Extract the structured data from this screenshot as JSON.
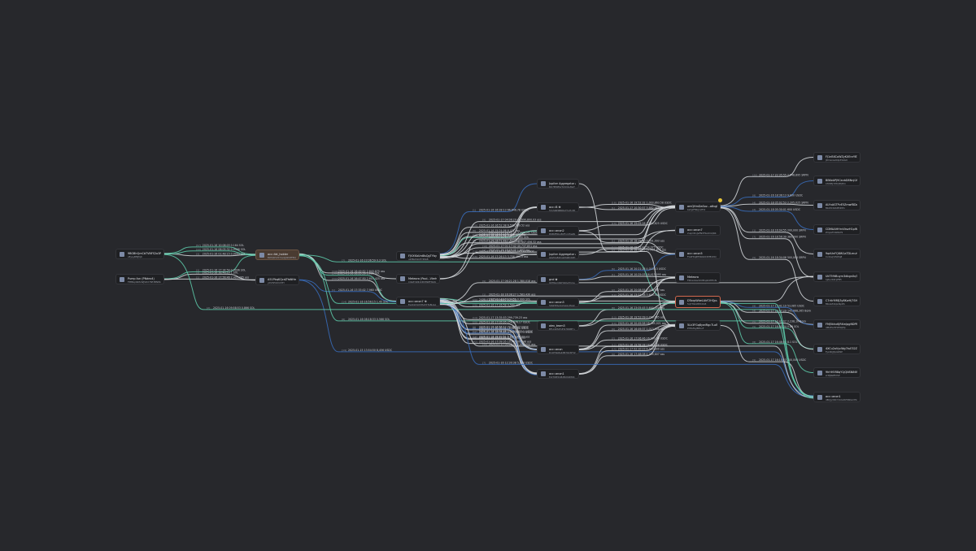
{
  "colors": {
    "background": "#27282c",
    "node_bg": "#1f2023",
    "edge_teal": "#5fcfae",
    "edge_blue": "#3a6fbf",
    "edge_white": "#d7dade",
    "edge_grey": "#8d9099",
    "highlight_node": "#4a3b31",
    "selected_border": "#d2694e",
    "badge": "#e8c53a"
  },
  "nodes": [
    {
      "id": "n1",
      "icon": "wallet-icon",
      "title": "9BGBhQmCbTVNFS2o3PYqnRcAFbqsAR9n",
      "sub": "vEyLyBMJfqK"
    },
    {
      "id": "n2",
      "icon": "wallet-icon",
      "title": "Pump.fun (PNdex4)",
      "sub": "FP8Nq4bMvWJSDX76E3BN8bKGzdYje7Pz8 DSGJ4b7Zu9"
    },
    {
      "id": "n3",
      "icon": "wallet-icon",
      "title": "acc::fat_holder",
      "sub": "BWQWvMrmsdgWU8FBQ7wnc3fG4nqzzbefQ WnXpGQRQCfE"
    },
    {
      "id": "n4",
      "icon": "wallet-icon",
      "title": "A51PbqKQcdZYaNHmoU9ryBAgKKHrfgj",
      "sub": "ybVW54mCfZY"
    },
    {
      "id": "n5",
      "icon": "wallet-icon",
      "title": "FJVXKbUrd8sQgTYbyRBjsLnaTn2vB6HKqn",
      "sub": "uZtNyDxkHYRtpB"
    },
    {
      "id": "n6",
      "icon": "wallet-icon",
      "title": "Meteora (Pool...Vlerhsnlb)",
      "sub": "C9zZYkNUV4MHWfHSdKwd2PYRWHSFACXQ Te5Cpu6TG9t"
    },
    {
      "id": "n7",
      "icon": "wallet-icon",
      "title": "acc::anon7 ☢",
      "sub": "Ee1JjkX1XVHeTdTLBLGAVb1w9YeMQpQ7tl ZpY4GEHPbWmXE"
    },
    {
      "id": "n8",
      "icon": "agg-icon",
      "title": "Jupiter Aggregator Authority...",
      "sub": "BQ7BfjMSxTyVQ2uMaTBvYTX4v9mnBY5 u3TuCpn7ogx"
    },
    {
      "id": "n9",
      "icon": "wallet-icon",
      "title": "acc::B ☢",
      "sub": "5YuSRZSBRRgYhyHcPXBSgNVZfF6Rwm68 Yf6tFC6mSAEMsz"
    },
    {
      "id": "n10",
      "icon": "wallet-icon",
      "title": "acc::anon2",
      "sub": "DKBdF6bu5DFnrdhwPqaVHGmKdbVAgKqaV NQBkVQFD4"
    },
    {
      "id": "n11",
      "icon": "agg-icon",
      "title": "Jupiter Aggregator Authority 1...",
      "sub": "GKZXp84XqsMg6DXZHrq4Ubgh6yBQvT3k Ab4qGeSqdjwSN"
    },
    {
      "id": "n12",
      "icon": "wallet-icon",
      "title": "grol ✿",
      "sub": "9XTNuCjRkHj4Xe7hmeLbGdR1f3nMa1aaPZ9 pQAgDVuyrG"
    },
    {
      "id": "n13",
      "icon": "wallet-icon",
      "title": "acc::anon3",
      "sub": "5bW5Mv2pVyJzqyHpzz7bSkwYtHuqq1qYFk XDXQaHAWVnBZ6"
    },
    {
      "id": "n14",
      "icon": "wallet-icon",
      "title": "alex_team3",
      "sub": "BFLk2MgFxEhj7DRBTn9uRcGX8TXhKzaKcB a2AuMnSZM38"
    },
    {
      "id": "n15",
      "icon": "wallet-icon",
      "title": "acc::anon",
      "sub": "D1QFRgPeK3B7KCSF32GkYxyJ3FcEXbZ3GD Tp8aHAU6VVSPx"
    },
    {
      "id": "n16",
      "icon": "wallet-icon",
      "title": "acc::anon1",
      "sub": "ELt7JREXnBzBUXkMCKSkFmsCwTYKS4h1uHBi 4uLZhQPw"
    },
    {
      "id": "n17",
      "icon": "wallet-icon",
      "title": "amQHmDaSoz...a6vgNkgJHMpoYqTsEmbP",
      "sub": "bsVjzFMbj1LfH4"
    },
    {
      "id": "n18",
      "icon": "wallet-icon",
      "title": "acc::anon7",
      "sub": "2uqmDvJvPNVFKu6mQR47xLpyzQuHyKZ Br7n3NdCb4X7"
    },
    {
      "id": "n19",
      "icon": "wallet-icon",
      "title": "acc::anon5",
      "sub": "FG9Htq6fMWa6XDYBUDQXkxPp9Wfu2QqLT 4TLYKbkMPp2"
    },
    {
      "id": "n20",
      "icon": "wallet-icon",
      "title": "Meteora",
      "sub": "FKCavzavzUXBnpK4HHnNbmnBvgxdYDMVpY Cm3nAHUxuY2G"
    },
    {
      "id": "n21",
      "icon": "wallet-icon",
      "title": "DToxpWbeLAkF2HQpuo9Ss8SBWJy9W15",
      "sub": "5q7T9z1HPCXA5"
    },
    {
      "id": "n22",
      "icon": "wallet-icon",
      "title": "5Lk3FGq8ywiRgc7LoBkMrqd4Z3MHZnHH",
      "sub": "P7BxfbyBEbuF"
    },
    {
      "id": "n23",
      "icon": "wallet-icon",
      "title": "FJ1nBXCoWZyKXEnrYBTQr8Y9M27A8nsY",
      "sub": "JDmsxLa9dp3VAG9"
    },
    {
      "id": "n24",
      "icon": "wallet-icon",
      "title": "BBKeAPJ9CevbD8Nnj0Ag8oRMk77Ab9U",
      "sub": "Cf93EJYPXQPQPm"
    },
    {
      "id": "n25",
      "icon": "wallet-icon",
      "title": "ALYxAGTPvE5ZmwfBDoAAbAu9Wwb5rtFG2",
      "sub": "MkWCSdbB5Pdfv"
    },
    {
      "id": "n26",
      "icon": "wallet-icon",
      "title": "CDMAAHHrvVkszH1pWDi19FHnmVS5wxGQ",
      "sub": "ZmjoZ3dk8AY9"
    },
    {
      "id": "n27",
      "icon": "wallet-icon",
      "title": "9qdUnFQ8W1aTDLmuhm4SRGWtt3Qk9G7gBo",
      "sub": "Cx1GqVWWq8"
    },
    {
      "id": "n28",
      "icon": "wallet-icon",
      "title": "UkT59tBuyrn3dbgnXq7qkjAhP7ZEPYfXSA",
      "sub": "hJALxSNrpFB5"
    },
    {
      "id": "n29",
      "icon": "wallet-icon",
      "title": "C7rtkYM8J3y8KwHj7SHr2xCgtrqtWmBpGD",
      "sub": "MbskZdkpLNpDS"
    },
    {
      "id": "n30",
      "icon": "wallet-icon",
      "title": "FMJ5khx6jRKmJqgftDPBRnd2TtVMYydQS4U9",
      "sub": "4MAtSx5HdMqMp"
    },
    {
      "id": "n31",
      "icon": "wallet-icon",
      "title": "4XCu2oVycWg7tuE32Zr5hpYB5snvCmpW",
      "sub": "FyLNQJ3pGNSP"
    },
    {
      "id": "n32",
      "icon": "wallet-icon",
      "title": "9hHH5R8qY1jQNSN86SDWKF2WxeTFYmqEN",
      "sub": "zrMJRefEXSP"
    },
    {
      "id": "n33",
      "icon": "wallet-icon",
      "title": "acc::anon1",
      "sub": "4BCJyVRCY1UG2KT9NGmEbjbQN7jEbFz3Z2BRqRPEU MiLkM"
    }
  ],
  "edges": [
    {
      "from": "n1",
      "to": "n3",
      "color": "teal",
      "label": "2025-01-16 10:08:03 0.164 SOL",
      "tag": "[57]"
    },
    {
      "from": "n1",
      "to": "n3",
      "color": "white",
      "label": "2025-01-16 01:48:15 0.0095 SOL",
      "tag": "[3]"
    },
    {
      "from": "n1",
      "to": "n3",
      "color": "teal",
      "label": "2025-01-16 06:05:32 0.0598 SOL",
      "tag": "[10]"
    },
    {
      "from": "n2",
      "to": "n3",
      "color": "teal",
      "label": "2025-01-16 17:34:54 0.3096 SOL",
      "tag": "[3]"
    },
    {
      "from": "n2",
      "to": "n4",
      "color": "white",
      "label": "2025-01-16 17:56:46 2,495,365 ass",
      "tag": "[1]"
    },
    {
      "from": "n2",
      "to": "n4",
      "color": "white",
      "label": "2025-01-16 16:46:29 1 SOL",
      "tag": "[3]"
    },
    {
      "from": "n3",
      "to": "n7",
      "color": "white",
      "label": "2025-01-16 16:47:50 2,603,425 ass",
      "tag": "[342]"
    },
    {
      "from": "n3",
      "to": "n7",
      "color": "teal",
      "label": "2025-01-16 16:25:59 1.025 SOL",
      "tag": "[344]"
    },
    {
      "from": "n3",
      "to": "n6",
      "color": "white",
      "label": "2025-01-16 16:49:52 2,643,875 ass",
      "tag": "[346]"
    },
    {
      "from": "n4",
      "to": "n7",
      "color": "blue",
      "label": "2025-01-16 17:33:02 7,960 USDC",
      "tag": "[1]"
    },
    {
      "from": "n3",
      "to": "n21",
      "color": "teal",
      "label": "2025-01-16 23:36:59 0.3 SOL",
      "tag": "[7]"
    },
    {
      "from": "n4",
      "to": "n33",
      "color": "blue",
      "label": "2025-01-15 13:54:50 8,456 USDC",
      "tag": "[19]"
    },
    {
      "from": "n3",
      "to": "n33",
      "color": "teal",
      "label": "2025-01-16 08:18:33 0.566 SOL",
      "tag": "[8]"
    },
    {
      "from": "n5",
      "to": "n8",
      "color": "blue",
      "label": "2025-01-16 16:28:13 66,646.78 USDC",
      "tag": "[1]"
    },
    {
      "from": "n5",
      "to": "n9",
      "color": "white",
      "label": "2025-01-16 15:24:06 6,477 ass",
      "tag": "[8]"
    },
    {
      "from": "n5",
      "to": "n9",
      "color": "white",
      "label": "2025-01-16 16:52:38 6,596,389.52 ass",
      "tag": "[10]"
    },
    {
      "from": "n5",
      "to": "n9",
      "color": "white",
      "label": "2025-01-16 16:51:59 5,485,777 ass",
      "tag": "[12]"
    },
    {
      "from": "n5",
      "to": "n10",
      "color": "white",
      "label": "2025-01-16 16:51:49 1,637 USDC",
      "tag": "[9]"
    },
    {
      "from": "n5",
      "to": "n10",
      "color": "teal",
      "label": "2025-01-16 16:27:58 2.043 SOL",
      "tag": "[10]"
    },
    {
      "from": "n5",
      "to": "n11",
      "color": "white",
      "label": "2025-01-16 17:26:13 3,756,460.5 ass",
      "tag": "[18]"
    },
    {
      "from": "n5",
      "to": "n11",
      "color": "white",
      "label": "2025-01-16 17:31:12 80,271,115.63 USDC",
      "tag": "[14]"
    },
    {
      "from": "n7",
      "to": "n13",
      "color": "white",
      "label": "2025-01-16 17:26:58 9,560 ass",
      "tag": "[28]"
    },
    {
      "from": "n7",
      "to": "n13",
      "color": "teal",
      "label": "2025-01-16 15:06:57 0.3 SOL",
      "tag": "[29]"
    },
    {
      "from": "n7",
      "to": "n15",
      "color": "white",
      "label": "2025-01-17 13:35:53 299,739.23 ass",
      "tag": "[14]"
    },
    {
      "from": "n7",
      "to": "n15",
      "color": "blue",
      "label": "2025-01-16 16:56:12 74,385.07 USDC",
      "tag": "[9]"
    },
    {
      "from": "n7",
      "to": "n15",
      "color": "white",
      "label": "2025-01-16 17:05:05 256,976.17 USDC",
      "tag": "[20]"
    },
    {
      "from": "n7",
      "to": "n16",
      "color": "white",
      "label": "2025-01-17 00:30:52 16,081.96 USDC",
      "tag": "[8]"
    },
    {
      "from": "n7",
      "to": "n16",
      "color": "white",
      "label": "2025-01-16 15:42:02 8,733,023 ass",
      "tag": "[8]"
    },
    {
      "from": "n7",
      "to": "n16",
      "color": "white",
      "label": "2025-01-16 16:39:45 4,475,373.73 USDC",
      "tag": "[7]"
    },
    {
      "from": "n7",
      "to": "n16",
      "color": "white",
      "label": "2025-01-16 17:09:35 10,460,003.48 ass",
      "tag": "[42]"
    },
    {
      "from": "n7",
      "to": "n16",
      "color": "white",
      "label": "2025-01-16 18:49:51 5,623,147.03 ass",
      "tag": "[18]"
    },
    {
      "from": "n7",
      "to": "n16",
      "color": "blue",
      "label": "2025-01-16 18:04:48 14,600,025.1 USDC",
      "tag": "[12]"
    },
    {
      "from": "n7",
      "to": "n28",
      "color": "white",
      "label": "2025-01-18 09:04:51 0.999 SOL",
      "tag": "[8]"
    },
    {
      "from": "n7",
      "to": "n28",
      "color": "white",
      "label": "2025-01-17 06:21:28 1,380,018 ass",
      "tag": "[9]"
    },
    {
      "from": "n5",
      "to": "n17",
      "color": "white",
      "label": "2025-01-17 01:17:42 40,737,851 ass",
      "tag": "[16]"
    },
    {
      "from": "n5",
      "to": "n17",
      "color": "white",
      "label": "2025-01-17 18:40:20 3,003,141 USDC",
      "tag": "[10]"
    },
    {
      "from": "n5",
      "to": "n17",
      "color": "white",
      "label": "2025-01-17 04:06:29 40,690,800.03 ass",
      "tag": "[9]"
    },
    {
      "from": "n5",
      "to": "n17",
      "color": "white",
      "label": "2025-01-17 01:57:43 41,447,456.32 ass",
      "tag": "[11]"
    },
    {
      "from": "n6",
      "to": "n18",
      "color": "white",
      "label": "2025-01-16 16:49:45 1,893 ass",
      "tag": "[1]"
    },
    {
      "from": "n6",
      "to": "n18",
      "color": "white",
      "label": "2025-01-16 17:09:04 2.35 SOL",
      "tag": "[6]"
    },
    {
      "from": "n9",
      "to": "n17",
      "color": "white",
      "label": "2025-01-17 10:30:57 3,882,968 ass",
      "tag": "[1]"
    },
    {
      "from": "n9",
      "to": "n17",
      "color": "white",
      "label": "2025-01-16 19:52:32 1,003,863.58 USDC",
      "tag": "[18]"
    },
    {
      "from": "n10",
      "to": "n17",
      "color": "white",
      "label": "2025-01-16 15:05:28 1,054,625 USDC",
      "tag": "[10]"
    },
    {
      "from": "n10",
      "to": "n19",
      "color": "white",
      "label": "2025-01-16 18:28:40 3,001,093 ass",
      "tag": "[1]"
    },
    {
      "from": "n11",
      "to": "n19",
      "color": "white",
      "label": "2025-01-16 18:29:40 54,075 USDC",
      "tag": "[14]"
    },
    {
      "from": "n12",
      "to": "n19",
      "color": "blue",
      "label": "2025-01-16 20:21:28 4,010.13 USDC",
      "tag": "[6]"
    },
    {
      "from": "n12",
      "to": "n20",
      "color": "white",
      "label": "2025-01-16 10:25:03 16,413,095 ass",
      "tag": "[1]"
    },
    {
      "from": "n13",
      "to": "n20",
      "color": "white",
      "label": "2025-01-16 13:21:58 3,643.50 USDC",
      "tag": "[14]"
    },
    {
      "from": "n13",
      "to": "n20",
      "color": "white",
      "label": "2025-01-16 20:08:55 2,030,957 ass",
      "tag": "[2]"
    },
    {
      "from": "n14",
      "to": "n21",
      "color": "white",
      "label": "2025-01-16 23:05:45 5,600,000 ass",
      "tag": "[8]"
    },
    {
      "from": "n14",
      "to": "n21",
      "color": "white",
      "label": "2025-01-16 19:52:09 0,799,065 ass",
      "tag": "[13]"
    },
    {
      "from": "n15",
      "to": "n21",
      "color": "white",
      "label": "2025-01-16 20:49:58 28,765,021 ass",
      "tag": "[10]"
    },
    {
      "from": "n15",
      "to": "n22",
      "color": "white",
      "label": "2025-01-16 16:49:37 1,013,008 ass",
      "tag": "[9]"
    },
    {
      "from": "n15",
      "to": "n22",
      "color": "white",
      "label": "2025-01-16 17:06:46 16,990.09 USDC",
      "tag": "[7]"
    },
    {
      "from": "n16",
      "to": "n22",
      "color": "white",
      "label": "2025-01-16 19:58:28 18,081.58 USDC",
      "tag": "[12]"
    },
    {
      "from": "n16",
      "to": "n22",
      "color": "white",
      "label": "2025-01-16 17:48:08 4,209,807 ass",
      "tag": "[9]"
    },
    {
      "from": "n16",
      "to": "n22",
      "color": "white",
      "label": "2025-01-17 02:10:23 4,500,800 ass",
      "tag": "[14]"
    },
    {
      "from": "n17",
      "to": "n23",
      "color": "white",
      "label": "2025-01-17 22:35:55 2,848,895 SRPN",
      "tag": "[20]"
    },
    {
      "from": "n17",
      "to": "n24",
      "color": "blue",
      "label": "2025-01-16 18:36:13 9,800 USDC",
      "tag": "[8]"
    },
    {
      "from": "n17",
      "to": "n25",
      "color": "white",
      "label": "2025-01-18 05:02:53 2,205,025 SRPN",
      "tag": "[4]"
    },
    {
      "from": "n17",
      "to": "n26",
      "color": "blue",
      "label": "2025-01-18 05:30:01 600 USDC",
      "tag": "[2]"
    },
    {
      "from": "n17",
      "to": "n27",
      "color": "white",
      "label": "2025-01-18 16:04:55 200,000 SRPN",
      "tag": "[1]"
    },
    {
      "from": "n17",
      "to": "n28",
      "color": "white",
      "label": "2025-01-16 18:56:39 380,000 SRPN",
      "tag": "[7]"
    },
    {
      "from": "n17",
      "to": "n29",
      "color": "white",
      "label": "2025-01-16 18:34:06 500,000 SRPN",
      "tag": "[5]"
    },
    {
      "from": "n21",
      "to": "n30",
      "color": "white",
      "label": "2025-01-17 19:47:29 145,888,265 Bonk",
      "tag": "[4]"
    },
    {
      "from": "n21",
      "to": "n30",
      "color": "blue",
      "label": "2025-01-17 15:41:19 53,085 USDC",
      "tag": "[9]"
    },
    {
      "from": "n21",
      "to": "n31",
      "color": "teal",
      "label": "2025-01-17 16:00:04 0.86 SOL",
      "tag": "[5]"
    },
    {
      "from": "n21",
      "to": "n31",
      "color": "white",
      "label": "2025-01-17 16:43:07 2,238,10 Bonk",
      "tag": "[6]"
    },
    {
      "from": "n21",
      "to": "n32",
      "color": "teal",
      "label": "2025-01-17 16:46:02 8.1 SOL",
      "tag": "[8]"
    },
    {
      "from": "n22",
      "to": "n33",
      "color": "white",
      "label": "2025-01-17 16:10:23 200,000 USDC",
      "tag": "[9]"
    },
    {
      "from": "n1",
      "to": "n33",
      "color": "teal",
      "label": "2025-01-16 09:58:53 0.866 SOL",
      "tag": "[2]"
    },
    {
      "from": "n7",
      "to": "n33",
      "color": "blue",
      "label": "2025-01-16 12:30:38 5,000 USDC",
      "tag": "[7]"
    },
    {
      "from": "n7",
      "to": "n33",
      "color": "white",
      "label": "2025-01-17 00:08:50 2,998,000 ass",
      "tag": "[10]"
    },
    {
      "from": "n3",
      "to": "n33",
      "color": "teal",
      "label": "2025-01-16 16:56:15 1.45 SOL",
      "tag": "[14]"
    },
    {
      "from": "n7",
      "to": "n20",
      "color": "white",
      "label": "2025-01-18 16:38:27 1,583,430 ass",
      "tag": "[1]"
    },
    {
      "from": "n8",
      "to": "n22",
      "color": "white",
      "label": "2025-01-16 18:35:05 11,461,875 ass",
      "tag": "[2]"
    }
  ]
}
